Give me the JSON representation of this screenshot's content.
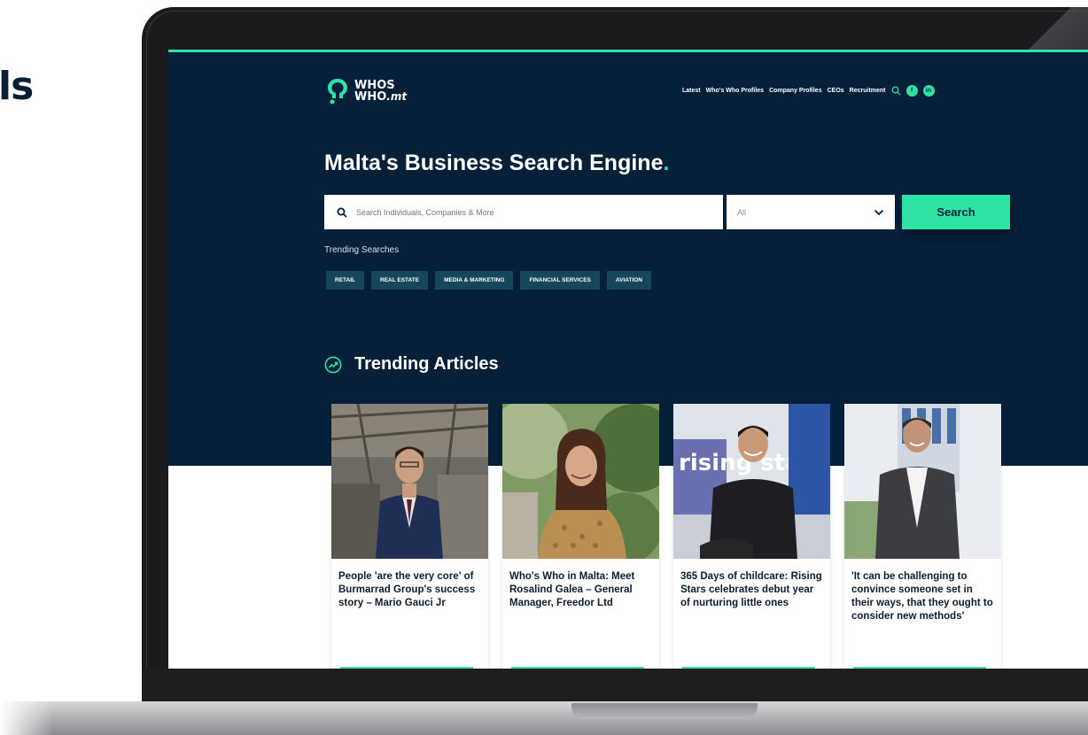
{
  "background_text": "ls",
  "colors": {
    "accent": "#2fe3a4",
    "navy": "#06203a"
  },
  "site": {
    "logo_line1": "WHOS",
    "logo_line2": "WHO",
    "logo_suffix": ".mt"
  },
  "nav": {
    "items": [
      "Latest",
      "Who's Who Profiles",
      "Company Profiles",
      "CEOs",
      "Recruitment"
    ],
    "icons": [
      "search-icon",
      "facebook-icon",
      "linkedin-icon"
    ],
    "facebook_glyph": "f",
    "linkedin_glyph": "in"
  },
  "hero": {
    "headline": "Malta's Business Search Engine",
    "headline_dot": ".",
    "search_placeholder": "Search Individuals, Companies & More",
    "select_value": "All",
    "search_button": "Search",
    "trending_label": "Trending Searches",
    "chips": [
      "RETAIL",
      "REAL ESTATE",
      "MEDIA & MARKETING",
      "FINANCIAL SERVICES",
      "AVIATION"
    ]
  },
  "trending": {
    "title": "Trending Articles",
    "articles": [
      {
        "title": "People 'are the very core' of Burmarrad Group's success story – Mario Gauci Jr"
      },
      {
        "title": "Who's Who in Malta: Meet Rosalind Galea – General Manager, Freedor Ltd"
      },
      {
        "title": "365 Days of childcare: Rising Stars celebrates debut year of nurturing little ones"
      },
      {
        "title": "'It can be challenging to convince someone set in their ways, that they ought to consider new methods'"
      }
    ],
    "sign_text": "rising sta"
  }
}
